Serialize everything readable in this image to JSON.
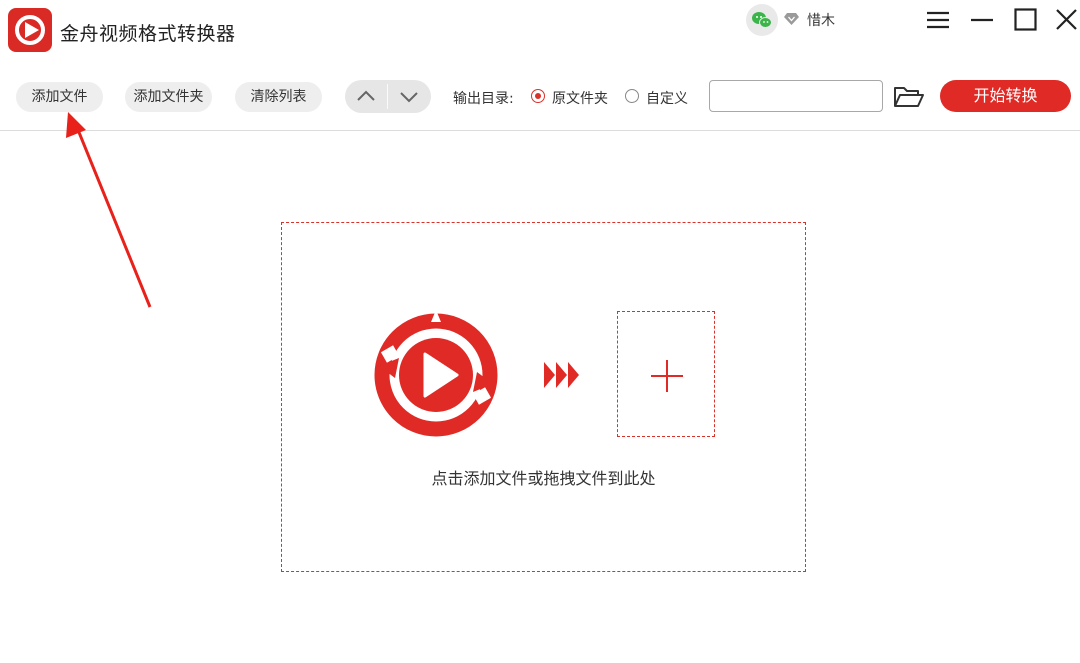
{
  "app": {
    "title": "金舟视频格式转换器",
    "accent_color": "#df2a26",
    "logo_icon": "play-refresh-icon"
  },
  "account": {
    "username": "惜木",
    "wechat_icon": "wechat-icon",
    "vip_icon": "diamond-icon"
  },
  "window_controls": [
    "menu-icon",
    "minimize-icon",
    "maximize-icon",
    "close-icon"
  ],
  "toolbar": {
    "add_file": "添加文件",
    "add_folder": "添加文件夹",
    "clear_list": "清除列表",
    "move_up_icon": "chevron-up-icon",
    "move_down_icon": "chevron-down-icon",
    "output_label": "输出目录:",
    "output_options": [
      {
        "label": "原文件夹",
        "selected": true
      },
      {
        "label": "自定义",
        "selected": false
      }
    ],
    "path_value": "",
    "folder_icon": "folder-open-icon",
    "start_button": "开始转换"
  },
  "dropzone": {
    "hint": "点击添加文件或拖拽文件到此处",
    "plus_icon": "plus-icon",
    "arrows_icon": "triple-arrow-icon"
  },
  "annotation": {
    "arrow_color": "#e8211b"
  }
}
